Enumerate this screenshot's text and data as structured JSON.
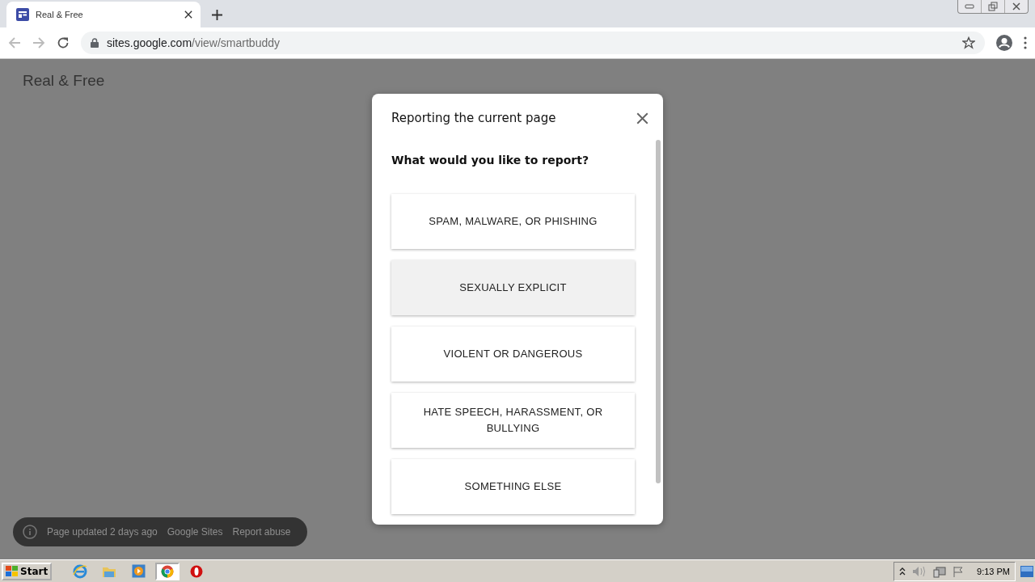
{
  "browser": {
    "tab": {
      "title": "Real & Free",
      "selected": true
    },
    "address": {
      "host": "sites.google.com",
      "path": "/view/smartbuddy"
    }
  },
  "page": {
    "site_title": "Real & Free"
  },
  "dialog": {
    "title": "Reporting the current page",
    "question": "What would you like to report?",
    "options": [
      {
        "label": "SPAM, MALWARE, OR PHISHING",
        "highlighted": false
      },
      {
        "label": "SEXUALLY EXPLICIT",
        "highlighted": true
      },
      {
        "label": "VIOLENT OR DANGEROUS",
        "highlighted": false
      },
      {
        "label": "HATE SPEECH, HARASSMENT, OR BULLYING",
        "highlighted": false
      },
      {
        "label": "SOMETHING ELSE",
        "highlighted": false
      }
    ]
  },
  "footer": {
    "updated": "Page updated 2 days ago",
    "links": [
      "Google Sites",
      "Report abuse"
    ]
  },
  "taskbar": {
    "start": "Start",
    "apps": [
      {
        "kind": "ie",
        "selected": false
      },
      {
        "kind": "folder",
        "selected": false
      },
      {
        "kind": "media",
        "selected": false
      },
      {
        "kind": "chrome",
        "selected": true
      },
      {
        "kind": "opera",
        "selected": false
      }
    ],
    "clock": "9:13 PM"
  }
}
